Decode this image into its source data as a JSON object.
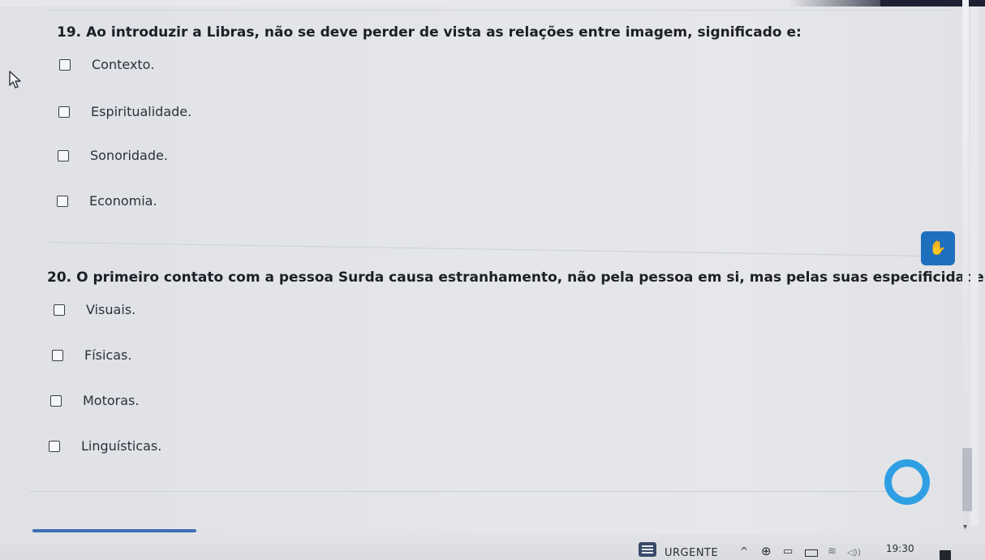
{
  "questions": [
    {
      "number": "19.",
      "text": "Ao introduzir a Libras, não se deve perder de vista as relações entre imagem, significado e:",
      "options": [
        "Contexto.",
        "Espiritualidade.",
        "Sonoridade.",
        "Economia."
      ]
    },
    {
      "number": "20.",
      "text": "O primeiro contato com a pessoa Surda causa estranhamento, não pela pessoa em si, mas pelas suas especificidades:",
      "options": [
        "Visuais.",
        "Físicas.",
        "Motoras.",
        "Linguísticas."
      ]
    }
  ],
  "taskbar": {
    "news_label": "URGENTE",
    "time": "19:30"
  },
  "icons": {
    "cursor": "mouse-cursor-icon",
    "side_widget": "hand-sign-icon",
    "loading": "loading-ring-icon"
  },
  "colors": {
    "accent": "#1f6fbf",
    "ring": "#2f9fe3",
    "progress": "#3d6fb5"
  }
}
